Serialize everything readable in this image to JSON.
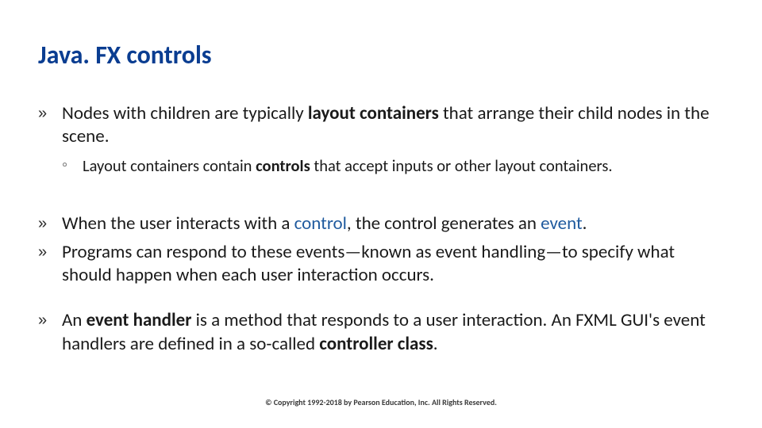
{
  "title": "Java. FX controls",
  "bullets": {
    "b1_pre": "Nodes with children are typically ",
    "b1_bold": "layout containers",
    "b1_post": " that arrange their child nodes in the scene.",
    "s1_pre": "Layout containers contain ",
    "s1_bold": "controls",
    "s1_post": " that accept inputs or other layout containers.",
    "b2_pre": "When the user interacts with a ",
    "b2_ctrl": "control",
    "b2_mid": ", the control generates an ",
    "b2_evt": "event",
    "b2_end": ".",
    "b3": "Programs can respond to these events—known as event handling—to specify what should happen when each user interaction occurs.",
    "b4_pre": "An ",
    "b4_eh": "event handler",
    "b4_mid": " is a method that responds to a user interaction. An FXML GUI's event handlers are defined in a so-called ",
    "b4_cc": "controller class",
    "b4_end": "."
  },
  "footer": "© Copyright 1992-2018 by Pearson Education, Inc. All Rights Reserved."
}
